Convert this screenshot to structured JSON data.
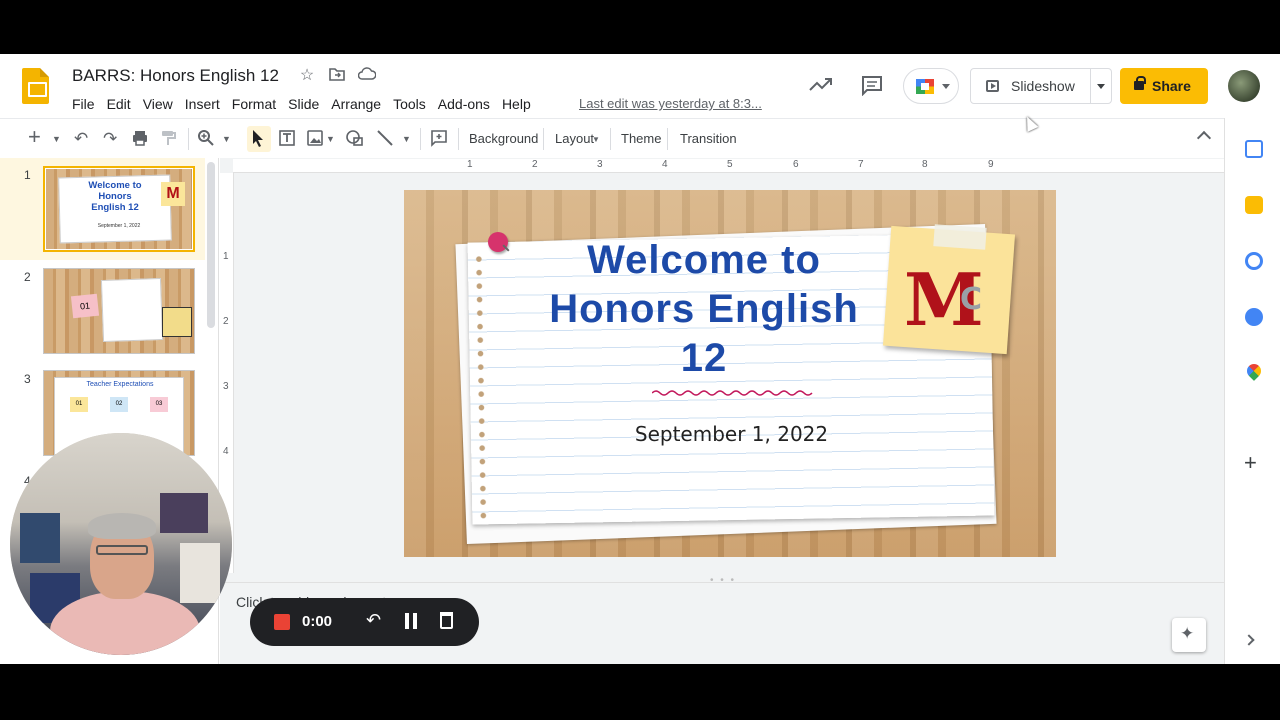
{
  "doc": {
    "title": "BARRS:  Honors English 12",
    "last_edit": "Last edit was yesterday at 8:3..."
  },
  "menu": [
    "File",
    "Edit",
    "View",
    "Insert",
    "Format",
    "Slide",
    "Arrange",
    "Tools",
    "Add-ons",
    "Help"
  ],
  "header": {
    "slideshow_label": "Slideshow",
    "share_label": "Share"
  },
  "toolbar": {
    "background": "Background",
    "layout": "Layout",
    "theme": "Theme",
    "transition": "Transition"
  },
  "ruler": {
    "h": [
      "1",
      "2",
      "3",
      "4",
      "5",
      "6",
      "7",
      "8",
      "9"
    ],
    "v": [
      "1",
      "2",
      "3",
      "4"
    ]
  },
  "filmstrip": {
    "numbers": [
      "1",
      "2",
      "3",
      "4"
    ],
    "slide1": {
      "title": "Welcome to Honors English 12",
      "date": "September 1, 2022",
      "logo": "M"
    },
    "slide2": {
      "badge": "01"
    },
    "slide3": {
      "title": "Teacher Expectations",
      "items": [
        "01",
        "02",
        "03"
      ]
    }
  },
  "slide": {
    "title_lines": [
      "Welcome to",
      "Honors English",
      "12"
    ],
    "date": "September 1, 2022",
    "logo_m": "M",
    "logo_c": "C"
  },
  "notes": {
    "placeholder": "Click to add speaker notes"
  },
  "recording": {
    "time": "0:00"
  },
  "colors": {
    "accent": "#fbbc04",
    "title_blue": "#1d4aa8",
    "logo_red": "#b0121a",
    "record_red": "#ea4335"
  }
}
